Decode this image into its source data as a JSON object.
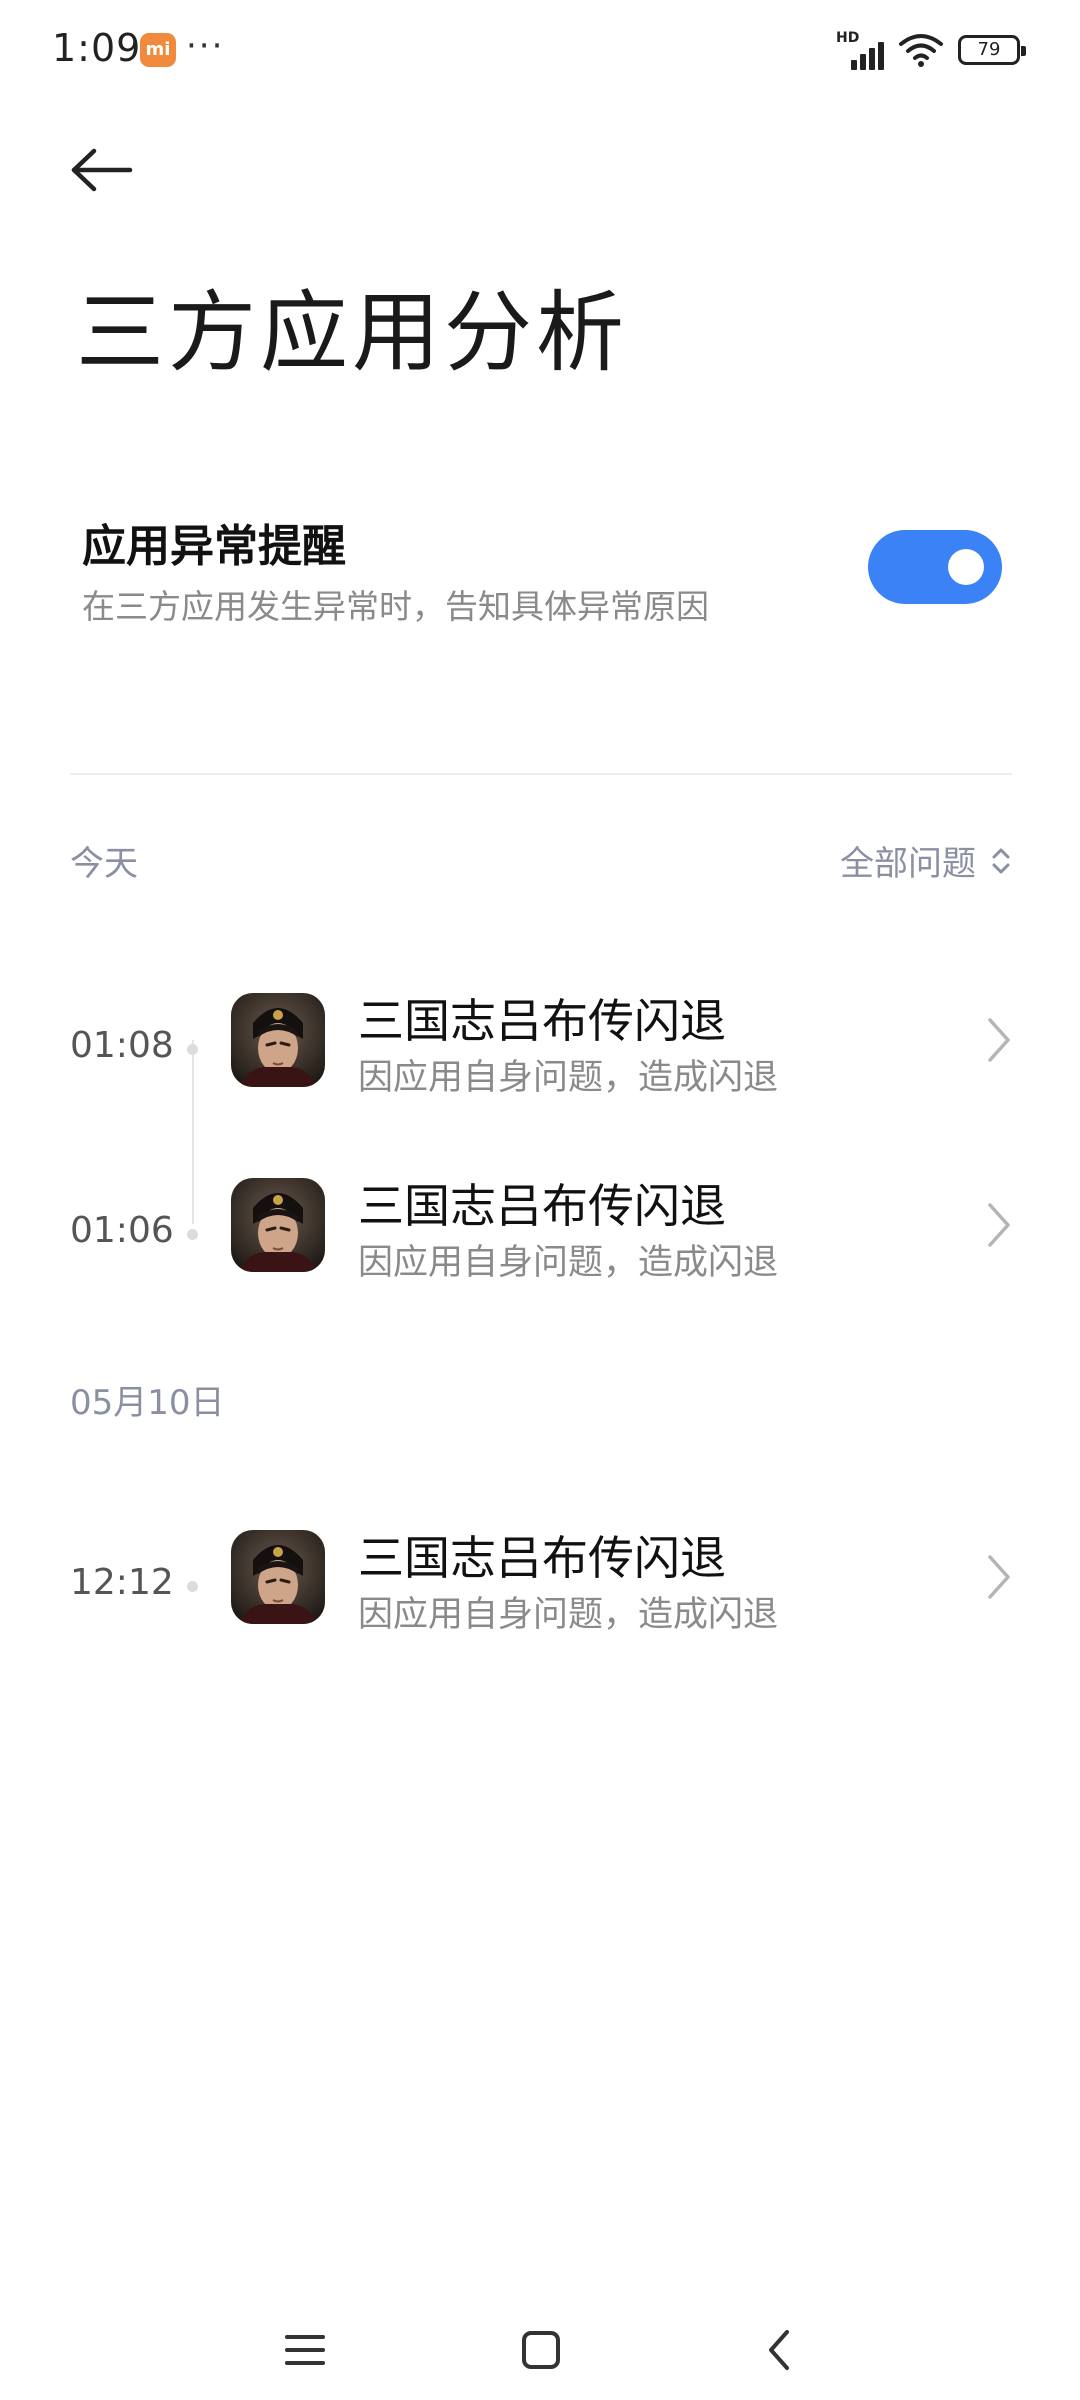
{
  "status_bar": {
    "time": "1:09",
    "mi_badge": "mi",
    "more": "···",
    "network": "HD",
    "battery": "79"
  },
  "header": {
    "title": "三方应用分析"
  },
  "setting": {
    "title": "应用异常提醒",
    "description": "在三方应用发生异常时，告知具体异常原因",
    "enabled": true
  },
  "filter": {
    "label": "全部问题"
  },
  "sections": [
    {
      "label": "今天",
      "items": [
        {
          "time": "01:08",
          "title": "三国志吕布传闪退",
          "subtitle": "因应用自身问题，造成闪退"
        },
        {
          "time": "01:06",
          "title": "三国志吕布传闪退",
          "subtitle": "因应用自身问题，造成闪退"
        }
      ]
    },
    {
      "label": "05月10日",
      "items": [
        {
          "time": "12:12",
          "title": "三国志吕布传闪退",
          "subtitle": "因应用自身问题，造成闪退"
        }
      ]
    }
  ],
  "icons": {
    "back": "back-arrow-icon",
    "toggle": "toggle-switch",
    "filter": "sort-updown-icon",
    "chevron": "chevron-right-icon",
    "nav_menu": "menu-icon",
    "nav_home": "home-square-icon",
    "nav_back": "back-chevron-icon"
  },
  "colors": {
    "accent": "#3b82f6",
    "muted": "#8a8fa3",
    "mi_orange": "#f08a3c"
  }
}
